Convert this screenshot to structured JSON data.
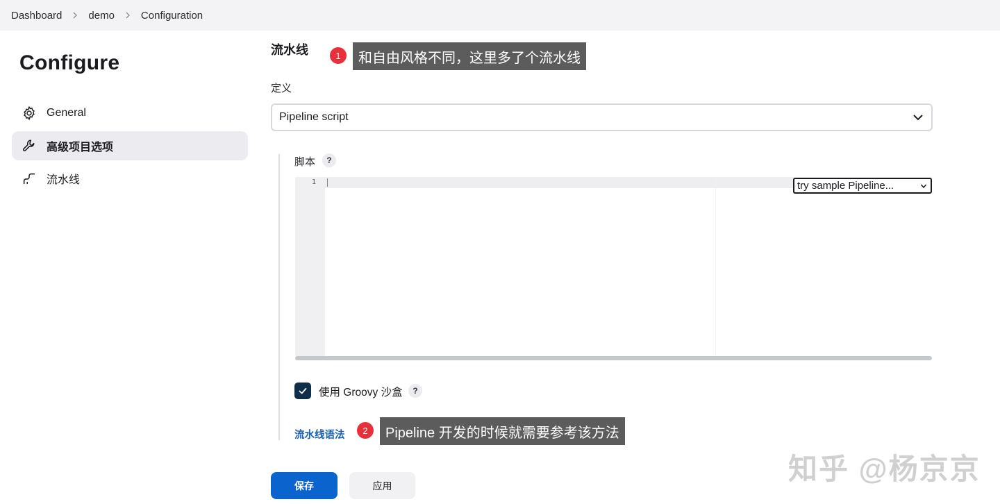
{
  "breadcrumb": [
    "Dashboard",
    "demo",
    "Configuration"
  ],
  "sidebar": {
    "title": "Configure",
    "items": [
      {
        "label": "General",
        "icon": "gear-icon"
      },
      {
        "label": "高级项目选项",
        "icon": "wrench-icon",
        "active": true
      },
      {
        "label": "流水线",
        "icon": "pipeline-icon"
      }
    ]
  },
  "main": {
    "section_title": "流水线",
    "definition_label": "定义",
    "definition_value": "Pipeline script",
    "script_label": "脚本",
    "help_symbol": "?",
    "editor_line_number": "1",
    "sample_select_value": "try sample Pipeline...",
    "sandbox_label": "使用 Groovy 沙盒",
    "sandbox_checked": true,
    "syntax_link": "流水线语法"
  },
  "buttons": {
    "save": "保存",
    "apply": "应用"
  },
  "annotations": [
    {
      "number": "1",
      "text": "和自由风格不同，这里多了个流水线"
    },
    {
      "number": "2",
      "text": "Pipeline 开发的时候就需要参考该方法"
    }
  ],
  "watermark": "知乎 @杨京京",
  "colors": {
    "primary": "#0b63ce",
    "link": "#1a63b8",
    "checkbox": "#0f2e4a",
    "annotation_badge": "#e8303a",
    "annotation_box": "#5c5c5c"
  }
}
